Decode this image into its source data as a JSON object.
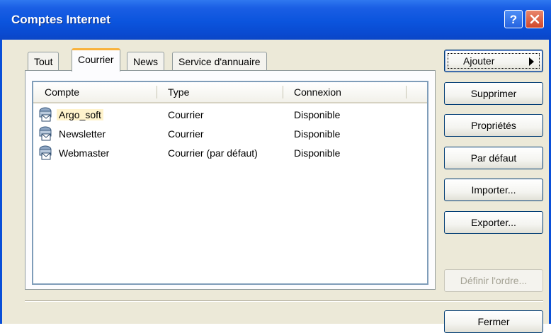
{
  "window": {
    "title": "Comptes Internet",
    "help_label": "?"
  },
  "tabs": [
    {
      "label": "Tout",
      "active": false
    },
    {
      "label": "Courrier",
      "active": true
    },
    {
      "label": "News",
      "active": false
    },
    {
      "label": "Service d'annuaire",
      "active": false
    }
  ],
  "list": {
    "columns": [
      "Compte",
      "Type",
      "Connexion"
    ],
    "rows": [
      {
        "compte": "Argo_soft",
        "type": "Courrier",
        "connexion": "Disponible",
        "icon": "mail-account-icon"
      },
      {
        "compte": "Newsletter",
        "type": "Courrier",
        "connexion": "Disponible",
        "icon": "mail-account-icon"
      },
      {
        "compte": "Webmaster",
        "type": "Courrier (par défaut)",
        "connexion": "Disponible",
        "icon": "mail-account-icon"
      }
    ]
  },
  "buttons": {
    "ajouter": "Ajouter",
    "supprimer": "Supprimer",
    "proprietes": "Propriétés",
    "par_defaut": "Par défaut",
    "importer": "Importer...",
    "exporter": "Exporter...",
    "definir_ordre": "Définir l'ordre...",
    "fermer": "Fermer"
  },
  "colors": {
    "titlebar": "#0b54dd",
    "dialog_bg": "#ece9d8",
    "tab_highlight": "#f9b23c",
    "close_button": "#d1472a"
  }
}
